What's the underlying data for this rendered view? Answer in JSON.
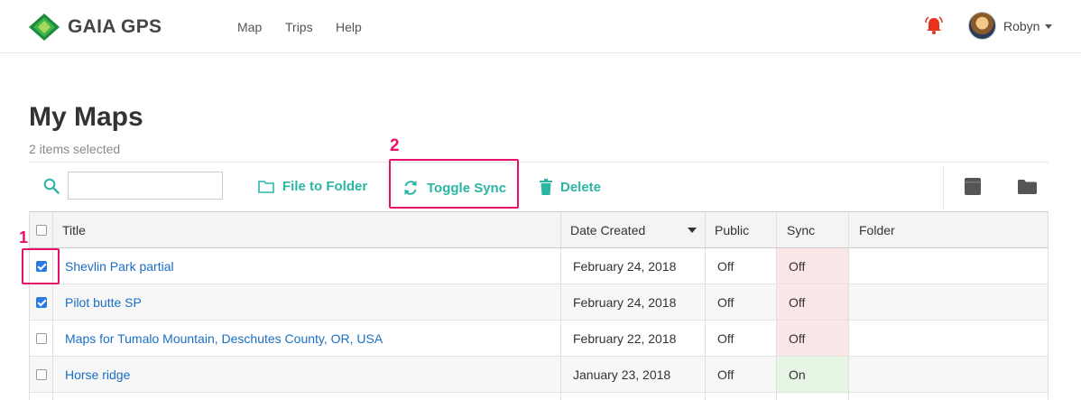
{
  "header": {
    "logo_text": "GAIA GPS",
    "nav": [
      "Map",
      "Trips",
      "Help"
    ],
    "user_name": "Robyn"
  },
  "page": {
    "title": "My Maps",
    "subtitle": "2 items selected"
  },
  "toolbar": {
    "search_value": "",
    "file_to_folder": "File to Folder",
    "toggle_sync": "Toggle Sync",
    "delete": "Delete"
  },
  "annotations": [
    "1",
    "2"
  ],
  "table": {
    "columns": [
      "Title",
      "Date Created",
      "Public",
      "Sync",
      "Folder"
    ],
    "rows": [
      {
        "checked": true,
        "title": "Shevlin Park partial",
        "date": "February 24, 2018",
        "public": "Off",
        "sync": "Off",
        "folder": ""
      },
      {
        "checked": true,
        "title": "Pilot butte SP",
        "date": "February 24, 2018",
        "public": "Off",
        "sync": "Off",
        "folder": ""
      },
      {
        "checked": false,
        "title": "Maps for Tumalo Mountain, Deschutes County, OR, USA",
        "date": "February 22, 2018",
        "public": "Off",
        "sync": "Off",
        "folder": ""
      },
      {
        "checked": false,
        "title": "Horse ridge",
        "date": "January 23, 2018",
        "public": "Off",
        "sync": "On",
        "folder": ""
      }
    ]
  },
  "colors": {
    "accent": "#2bb5a5",
    "link": "#1a6fc4",
    "annotation": "#e8106a",
    "sync_off_bg": "#fbe7e7",
    "sync_on_bg": "#e6f5e4",
    "bell": "#e8321c"
  }
}
